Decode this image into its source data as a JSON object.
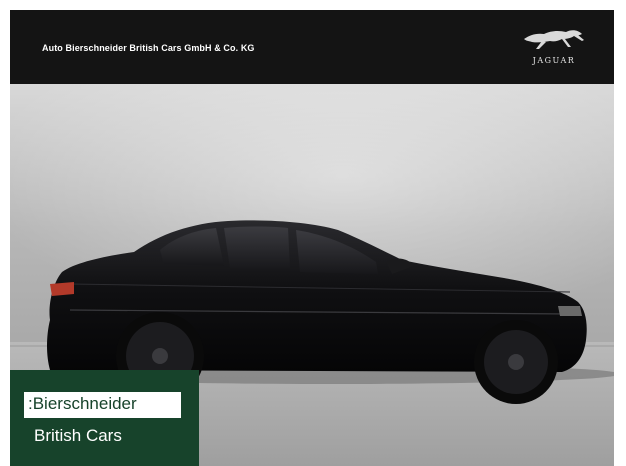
{
  "header": {
    "dealer_name": "Auto Bierschneider British Cars GmbH & Co. KG",
    "brand_wordmark": "JAGUAR",
    "brand_logo_icon": "leaping-jaguar-icon"
  },
  "photo": {
    "subject": "car-photo",
    "car_color": "#0b0b0d",
    "backdrop_color": "#bcbcbc"
  },
  "badge": {
    "line1": ":Bierschneider",
    "line2": "British Cars",
    "bg_color": "#17432b"
  }
}
